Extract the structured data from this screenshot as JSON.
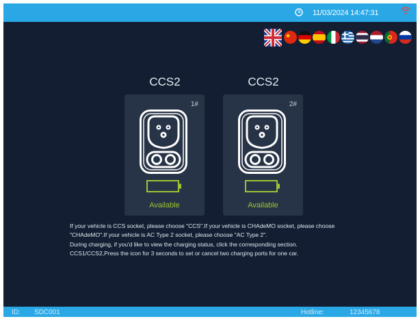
{
  "header": {
    "datetime": "11/03/2024 14:47:31",
    "clock_icon": "clock-icon",
    "wifi_icon": "wifi-icon"
  },
  "languages": [
    {
      "name": "flag-uk"
    },
    {
      "name": "flag-china"
    },
    {
      "name": "flag-germany"
    },
    {
      "name": "flag-spain"
    },
    {
      "name": "flag-italy"
    },
    {
      "name": "flag-greece"
    },
    {
      "name": "flag-thailand"
    },
    {
      "name": "flag-netherlands"
    },
    {
      "name": "flag-portugal"
    },
    {
      "name": "flag-russia"
    }
  ],
  "connectors": [
    {
      "title": "CCS2",
      "number": "1#",
      "status": "Available"
    },
    {
      "title": "CCS2",
      "number": "2#",
      "status": "Available"
    }
  ],
  "instructions": {
    "line1": "If your vehicle is CCS socket, please choose \"CCS\".If your vehicle is CHAdeMO socket, please choose",
    "line2": "\"CHAdeMO\".If your vehicle is AC Type 2 socket, please choose \"AC Type 2\".",
    "line3": "During charging, if you'd like to view the charging status, click the corresponding section.",
    "line4": "CCS1/CCS2,Press the icon for 3 seconds to set or cancel two charging ports for one car."
  },
  "footer": {
    "id_label": "ID:",
    "id_value": "SDC001",
    "hotline_label": "Hotline:",
    "hotline_value": "12345678"
  },
  "colors": {
    "bar": "#2aa8e6",
    "background": "#131e32",
    "card": "#273346",
    "available": "#9ec534"
  }
}
